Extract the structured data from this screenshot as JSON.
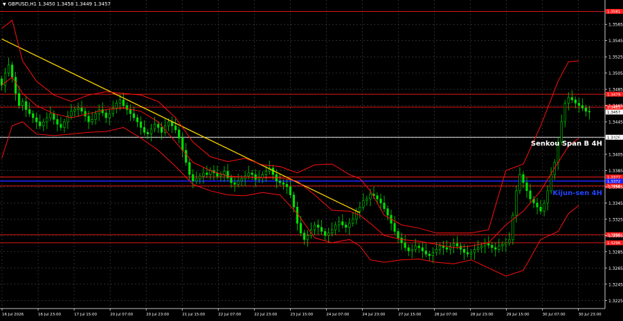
{
  "header": {
    "symbol_info": "GBPUSD,H1  1.3450 1.3458 1.3449 1.3457",
    "menu_icon": "triangle-down-icon"
  },
  "chart_data": {
    "type": "candlestick",
    "symbol": "GBPUSD",
    "timeframe": "H1",
    "ohlc_header": {
      "open": 1.345,
      "high": 1.3458,
      "low": 1.3449,
      "close": 1.3457
    },
    "ylim": [
      1.3215,
      1.3595
    ],
    "y_ticks": [
      "1.3565",
      "1.3545",
      "1.3525",
      "1.3505",
      "1.3485",
      "1.3465",
      "1.3445",
      "1.3425",
      "1.3405",
      "1.3385",
      "1.3365",
      "1.3345",
      "1.3325",
      "1.3305",
      "1.3285",
      "1.3265",
      "1.3245",
      "1.3225"
    ],
    "x_ticks": [
      "16 Jul 2026",
      "16 Jul 23:00",
      "17 Jul 15:00",
      "20 Jul 07:00",
      "20 Jul 23:00",
      "21 Jul 15:00",
      "22 Jul 07:00",
      "22 Jul 23:00",
      "23 Jul 15:00",
      "24 Jul 07:00",
      "24 Jul 23:00",
      "27 Jul 15:00",
      "28 Jul 07:00",
      "28 Jul 23:00",
      "29 Jul 15:00",
      "30 Jul 07:00",
      "30 Jul 23:00"
    ],
    "current_price": "1.3457",
    "closes": [
      1.349,
      1.3505,
      1.3515,
      1.35,
      1.348,
      1.3465,
      1.347,
      1.346,
      1.3455,
      1.345,
      1.3445,
      1.344,
      1.3445,
      1.345,
      1.3455,
      1.3448,
      1.3442,
      1.3438,
      1.3445,
      1.3452,
      1.3458,
      1.346,
      1.3462,
      1.3458,
      1.3452,
      1.3445,
      1.3448,
      1.3455,
      1.346,
      1.3456,
      1.345,
      1.3455,
      1.3462,
      1.3468,
      1.3472,
      1.3465,
      1.346,
      1.3455,
      1.345,
      1.3445,
      1.3438,
      1.3432,
      1.343,
      1.3436,
      1.3442,
      1.3438,
      1.3432,
      1.344,
      1.3445,
      1.344,
      1.3435,
      1.3425,
      1.341,
      1.3395,
      1.338,
      1.3372,
      1.3375,
      1.3378,
      1.3382,
      1.338,
      1.3385,
      1.3382,
      1.3378,
      1.338,
      1.3384,
      1.3376,
      1.337,
      1.3368,
      1.3372,
      1.3375,
      1.3378,
      1.3382,
      1.338,
      1.3374,
      1.3376,
      1.338,
      1.3384,
      1.3388,
      1.338,
      1.3372,
      1.337,
      1.3368,
      1.3365,
      1.3355,
      1.334,
      1.332,
      1.3308,
      1.33,
      1.3305,
      1.3312,
      1.3318,
      1.3315,
      1.331,
      1.3305,
      1.3308,
      1.3312,
      1.3318,
      1.3322,
      1.3318,
      1.3315,
      1.332,
      1.3325,
      1.3335,
      1.334,
      1.3348,
      1.335,
      1.3356,
      1.3354,
      1.335,
      1.3345,
      1.3338,
      1.333,
      1.332,
      1.331,
      1.3302,
      1.3296,
      1.329,
      1.3286,
      1.3288,
      1.3292,
      1.329,
      1.3286,
      1.3282,
      1.328,
      1.3284,
      1.3288,
      1.3292,
      1.329,
      1.3288,
      1.3292,
      1.3295,
      1.3292,
      1.3288,
      1.3284,
      1.3282,
      1.3284,
      1.3288,
      1.329,
      1.3292,
      1.3295,
      1.3293,
      1.329,
      1.3288,
      1.3292,
      1.3294,
      1.3296,
      1.33,
      1.333,
      1.336,
      1.338,
      1.337,
      1.336,
      1.335,
      1.3345,
      1.334,
      1.3335,
      1.3345,
      1.336,
      1.338,
      1.3395,
      1.342,
      1.3445,
      1.3468,
      1.3475,
      1.3472,
      1.3468,
      1.3465,
      1.3462,
      1.3458,
      1.3457
    ],
    "series": [
      {
        "name": "Trend line",
        "color": "#ffd400",
        "x": [
          0,
          103
        ],
        "y": [
          1.3547,
          1.3333
        ]
      },
      {
        "name": "Kijun-sen 4H",
        "color": "#1f1fff",
        "level": 1.337
      },
      {
        "name": "Senkou Span B 4H",
        "color": "#ffffff",
        "level": 1.3426
      },
      {
        "name": "Bollinger upper",
        "color": "#ff1010",
        "x": [
          0,
          3,
          6,
          10,
          15,
          20,
          25,
          30,
          35,
          40,
          45,
          50,
          55,
          60,
          65,
          70,
          75,
          80,
          85,
          90,
          95,
          100,
          103,
          106,
          110,
          115,
          120,
          125,
          130,
          135,
          140,
          145,
          150,
          155,
          160,
          163,
          166
        ],
        "y": [
          1.356,
          1.357,
          1.352,
          1.3495,
          1.3478,
          1.347,
          1.3478,
          1.3482,
          1.348,
          1.3478,
          1.347,
          1.345,
          1.342,
          1.3402,
          1.3396,
          1.34,
          1.3392,
          1.339,
          1.3382,
          1.3392,
          1.3393,
          1.338,
          1.3375,
          1.336,
          1.333,
          1.3318,
          1.3314,
          1.3308,
          1.3308,
          1.3308,
          1.3312,
          1.3385,
          1.3393,
          1.344,
          1.3495,
          1.3519,
          1.352
        ]
      },
      {
        "name": "Bollinger middle",
        "color": "#ff1010",
        "x": [
          0,
          3,
          6,
          10,
          15,
          20,
          25,
          30,
          35,
          40,
          45,
          50,
          55,
          60,
          65,
          70,
          75,
          80,
          85,
          90,
          95,
          100,
          103,
          106,
          110,
          115,
          120,
          125,
          130,
          135,
          140,
          145,
          150,
          155,
          160,
          163,
          166
        ],
        "y": [
          1.349,
          1.35,
          1.348,
          1.3465,
          1.3455,
          1.345,
          1.3455,
          1.346,
          1.3462,
          1.3458,
          1.3445,
          1.342,
          1.3395,
          1.3385,
          1.3378,
          1.3377,
          1.3376,
          1.3376,
          1.3372,
          1.3355,
          1.3336,
          1.3335,
          1.333,
          1.332,
          1.3305,
          1.33,
          1.3298,
          1.3294,
          1.329,
          1.3292,
          1.3296,
          1.3318,
          1.3335,
          1.336,
          1.3395,
          1.3415,
          1.3425
        ]
      },
      {
        "name": "Bollinger lower",
        "color": "#ff1010",
        "x": [
          0,
          3,
          6,
          10,
          15,
          20,
          25,
          30,
          35,
          40,
          45,
          50,
          55,
          60,
          65,
          70,
          75,
          80,
          85,
          90,
          95,
          100,
          103,
          106,
          110,
          115,
          120,
          125,
          130,
          135,
          140,
          145,
          150,
          155,
          160,
          163,
          166
        ],
        "y": [
          1.34,
          1.344,
          1.3445,
          1.343,
          1.3428,
          1.343,
          1.3432,
          1.3433,
          1.3438,
          1.3425,
          1.341,
          1.339,
          1.3368,
          1.336,
          1.3355,
          1.3354,
          1.3358,
          1.3355,
          1.3332,
          1.3302,
          1.3296,
          1.33,
          1.3292,
          1.3275,
          1.3272,
          1.3275,
          1.3276,
          1.3272,
          1.327,
          1.3275,
          1.3265,
          1.3255,
          1.3262,
          1.33,
          1.331,
          1.3332,
          1.3342
        ]
      }
    ],
    "horizontal_levels": [
      {
        "price": 1.3581,
        "label": "1.3581",
        "color": "#ff1a1a"
      },
      {
        "price": 1.3479,
        "label": "1.3479",
        "color": "#ff1a1a"
      },
      {
        "price": 1.3463,
        "label": "1.3463",
        "color": "#ff1a1a"
      },
      {
        "price": 1.3426,
        "label": "1.3426",
        "color": "#ffffff"
      },
      {
        "price": 1.3377,
        "label": "1.3377",
        "color": "#ff1a1a"
      },
      {
        "price": 1.3372,
        "label": "1.3372",
        "color": "#1f1fff"
      },
      {
        "price": 1.3366,
        "label": "1.3366",
        "color": "#ff1a1a"
      },
      {
        "price": 1.3306,
        "label": "1.3306",
        "color": "#ff1a1a"
      },
      {
        "price": 1.3296,
        "label": "1.3296",
        "color": "#ff1a1a"
      }
    ],
    "annotations": [
      {
        "text": "Senkou Span B 4H",
        "price": 1.3419,
        "color": "#ffffff"
      },
      {
        "text": "Kijun-sen 4H",
        "price": 1.3358,
        "color": "#2244ff"
      }
    ],
    "colors": {
      "background": "#000000",
      "candles": "#00e000",
      "grid": "#4a4a4a",
      "axis_text": "#ffffff"
    },
    "grid": true
  }
}
